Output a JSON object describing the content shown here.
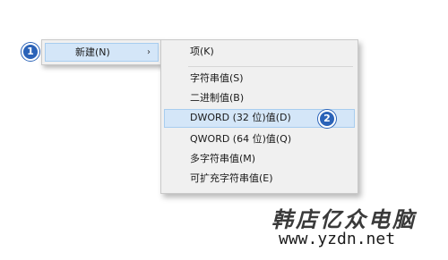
{
  "context_menu": {
    "new_item": {
      "label": "新建(N)",
      "arrow": "›"
    }
  },
  "submenu": {
    "items": [
      {
        "label": "项(K)"
      },
      {
        "label": "字符串值(S)"
      },
      {
        "label": "二进制值(B)"
      },
      {
        "label": "DWORD (32 位)值(D)"
      },
      {
        "label": "QWORD (64 位)值(Q)"
      },
      {
        "label": "多字符串值(M)"
      },
      {
        "label": "可扩充字符串值(E)"
      }
    ]
  },
  "badges": {
    "step1": "1",
    "step2": "2"
  },
  "watermark": {
    "title": "韩店亿众电脑",
    "url": "www.yzdn.net"
  },
  "colors": {
    "highlight": "#d4e6f8",
    "highlight_border": "#a8cdef",
    "badge": "#2b63b8",
    "menu_bg": "#f0f0f0"
  }
}
